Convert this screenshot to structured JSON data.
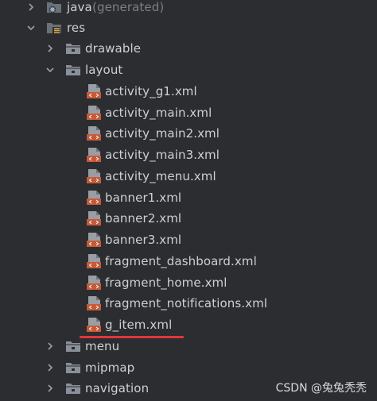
{
  "tree": {
    "items": [
      {
        "label": "java",
        "suffix": "(generated)",
        "type": "java-folder",
        "expanded": false
      },
      {
        "label": "res",
        "type": "res-folder",
        "expanded": true
      },
      {
        "label": "drawable",
        "type": "folder",
        "expanded": false
      },
      {
        "label": "layout",
        "type": "folder",
        "expanded": true
      },
      {
        "label": "activity_g1.xml",
        "type": "xml-file"
      },
      {
        "label": "activity_main.xml",
        "type": "xml-file"
      },
      {
        "label": "activity_main2.xml",
        "type": "xml-file"
      },
      {
        "label": "activity_main3.xml",
        "type": "xml-file"
      },
      {
        "label": "activity_menu.xml",
        "type": "xml-file"
      },
      {
        "label": "banner1.xml",
        "type": "xml-file"
      },
      {
        "label": "banner2.xml",
        "type": "xml-file"
      },
      {
        "label": "banner3.xml",
        "type": "xml-file"
      },
      {
        "label": "fragment_dashboard.xml",
        "type": "xml-file"
      },
      {
        "label": "fragment_home.xml",
        "type": "xml-file"
      },
      {
        "label": "fragment_notifications.xml",
        "type": "xml-file"
      },
      {
        "label": "g_item.xml",
        "type": "xml-file",
        "highlighted": true
      },
      {
        "label": "menu",
        "type": "folder",
        "expanded": false
      },
      {
        "label": "mipmap",
        "type": "folder",
        "expanded": false
      },
      {
        "label": "navigation",
        "type": "folder",
        "expanded": false
      }
    ]
  },
  "watermark": "CSDN @兔兔秃秃",
  "colors": {
    "background": "#2b2d30",
    "text": "#cdd0d4",
    "generated_text": "#7c7f84",
    "highlight_underline": "#e0363d",
    "xml_icon": "#c55a3a",
    "folder_icon": "#8a9099"
  }
}
